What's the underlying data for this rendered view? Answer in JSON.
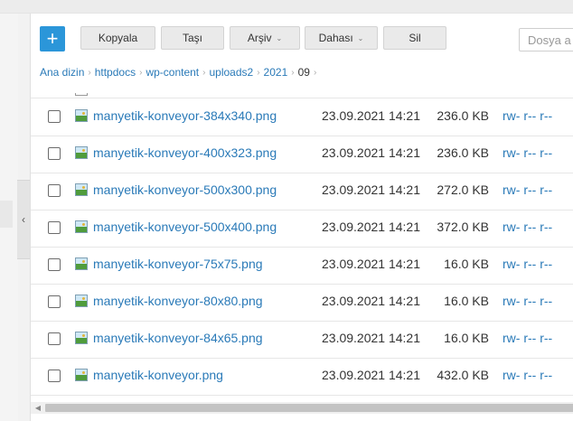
{
  "toolbar": {
    "add_label": "+",
    "copy_label": "Kopyala",
    "move_label": "Taşı",
    "archive_label": "Arşiv",
    "more_label": "Dahası",
    "delete_label": "Sil",
    "caret": "⌄"
  },
  "search": {
    "placeholder": "Dosya a"
  },
  "breadcrumb": {
    "items": [
      "Ana dizin",
      "httpdocs",
      "wp-content",
      "uploads2",
      "2021"
    ],
    "current": "09",
    "separator": "›"
  },
  "sidebar": {
    "collapse_glyph": "‹"
  },
  "files": [
    {
      "name": "manyetik-konveyor-384x340.png",
      "date": "23.09.2021 14:21",
      "size": "236.0 KB",
      "perm": "rw- r-- r--"
    },
    {
      "name": "manyetik-konveyor-400x323.png",
      "date": "23.09.2021 14:21",
      "size": "236.0 KB",
      "perm": "rw- r-- r--"
    },
    {
      "name": "manyetik-konveyor-500x300.png",
      "date": "23.09.2021 14:21",
      "size": "272.0 KB",
      "perm": "rw- r-- r--"
    },
    {
      "name": "manyetik-konveyor-500x400.png",
      "date": "23.09.2021 14:21",
      "size": "372.0 KB",
      "perm": "rw- r-- r--"
    },
    {
      "name": "manyetik-konveyor-75x75.png",
      "date": "23.09.2021 14:21",
      "size": "16.0 KB",
      "perm": "rw- r-- r--"
    },
    {
      "name": "manyetik-konveyor-80x80.png",
      "date": "23.09.2021 14:21",
      "size": "16.0 KB",
      "perm": "rw- r-- r--"
    },
    {
      "name": "manyetik-konveyor-84x65.png",
      "date": "23.09.2021 14:21",
      "size": "16.0 KB",
      "perm": "rw- r-- r--"
    },
    {
      "name": "manyetik-konveyor.png",
      "date": "23.09.2021 14:21",
      "size": "432.0 KB",
      "perm": "rw- r-- r--"
    }
  ],
  "scrollbar": {
    "left_arrow": "◀"
  },
  "colors": {
    "accent": "#2b96d9",
    "link": "#2a7ab8"
  }
}
